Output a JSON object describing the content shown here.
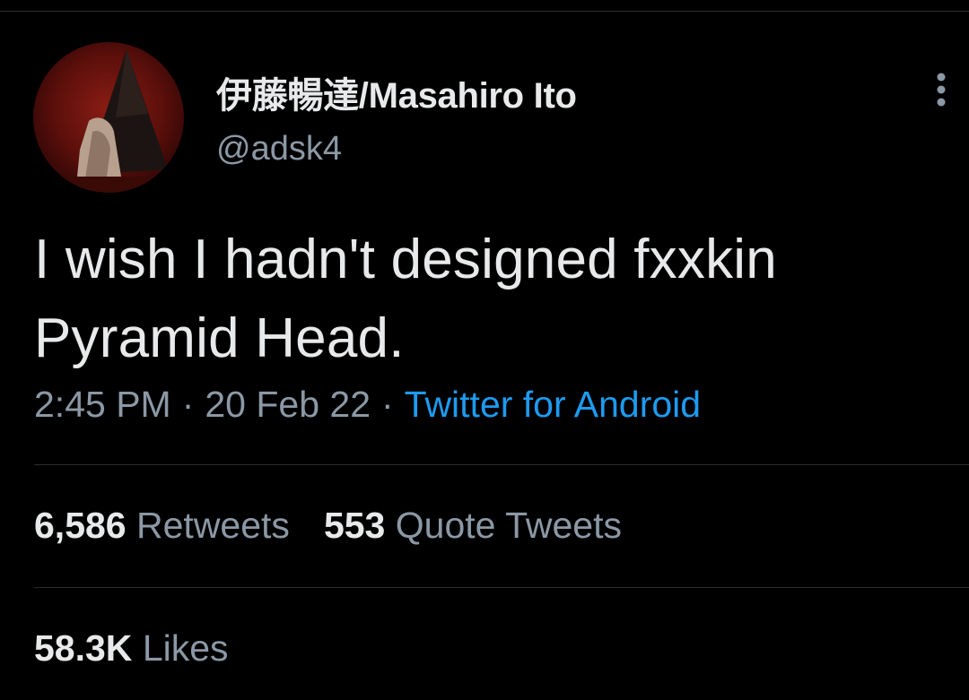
{
  "tweet": {
    "author": {
      "display_name": "伊藤暢達/Masahiro Ito",
      "handle": "@adsk4",
      "avatar_icon": "avatar-pyramid-head-image"
    },
    "text_line1": "I wish I hadn't designed fxxkin",
    "text_line2": "Pyramid Head.",
    "time": "2:45 PM",
    "date": "20 Feb 22",
    "separator": "·",
    "source": "Twitter for Android",
    "more_icon": "more-vertical-icon"
  },
  "stats": {
    "retweets_count": "6,586",
    "retweets_label": "Retweets",
    "quote_tweets_count": "553",
    "quote_tweets_label": "Quote Tweets",
    "likes_count": "58.3K",
    "likes_label": "Likes"
  },
  "colors": {
    "background": "#000000",
    "primary_text": "#e7e9ea",
    "secondary_text": "#8b98a5",
    "link": "#1d9bf0",
    "divider": "#2a2d30"
  }
}
